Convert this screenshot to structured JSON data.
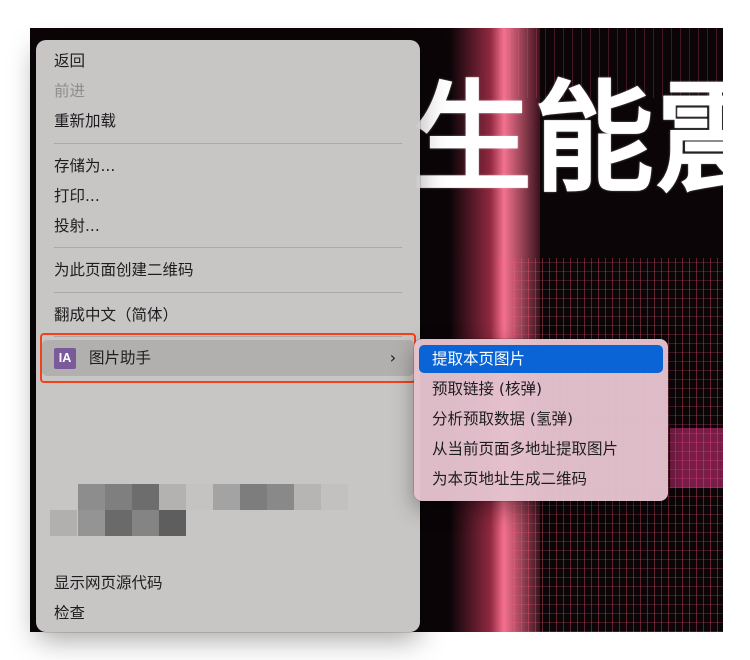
{
  "background": {
    "headline": "生能震"
  },
  "context_menu": {
    "items": {
      "back": "返回",
      "forward": "前进",
      "reload": "重新加载",
      "save_as": "存储为...",
      "print": "打印...",
      "cast": "投射...",
      "qr_code": "为此页面创建二维码",
      "translate": "翻成中文（简体）",
      "image_helper": "图片助手",
      "view_source": "显示网页源代码",
      "inspect": "检查"
    },
    "image_helper_icon_text": "IA",
    "image_helper_icon": "ia-extension-icon",
    "submenu_arrow_icon": "chevron-right-icon"
  },
  "submenu": {
    "items": [
      "提取本页图片",
      "预取链接 (核弹)",
      "分析预取数据 (氢弹)",
      "从当前页面多地址提取图片",
      "为本页地址生成二维码"
    ]
  },
  "colors": {
    "highlight": "#0a64d6",
    "annotation_box": "#f2421c",
    "ia_icon": "#7a5a9a"
  }
}
